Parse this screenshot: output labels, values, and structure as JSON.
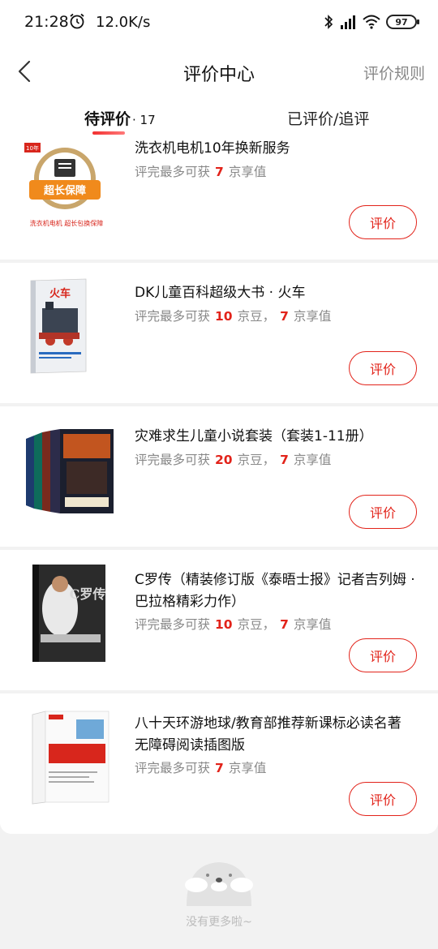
{
  "status_bar": {
    "time": "21:28",
    "speed": "12.0K/s",
    "battery": "97"
  },
  "header": {
    "title": "评价中心",
    "rules": "评价规则"
  },
  "tabs": {
    "pending": "待评价",
    "pending_count": "· 17",
    "done": "已评价/追评",
    "active": "pending"
  },
  "products": [
    {
      "name": "洗衣机电机10年换新服务",
      "reward_prefix": "评完最多可获",
      "reward_items": [
        {
          "num": "7",
          "unit": "京享值"
        }
      ],
      "button": "评价",
      "thumb_caption": "超长保障",
      "thumb_sub": "洗衣机电机 超长包换保障",
      "thumb_badge": "10年"
    },
    {
      "name": "DK儿童百科超级大书 · 火车",
      "reward_prefix": "评完最多可获",
      "reward_items": [
        {
          "num": "10",
          "unit": "京豆，"
        },
        {
          "num": "7",
          "unit": "京享值"
        }
      ],
      "button": "评价",
      "thumb_caption": "火车"
    },
    {
      "name": "灾难求生儿童小说套装（套装1-11册）",
      "reward_prefix": "评完最多可获",
      "reward_items": [
        {
          "num": "20",
          "unit": "京豆，"
        },
        {
          "num": "7",
          "unit": "京享值"
        }
      ],
      "button": "评价"
    },
    {
      "name": "C罗传（精装修订版《泰晤士报》记者吉列姆 · 巴拉格精彩力作）",
      "reward_prefix": "评完最多可获",
      "reward_items": [
        {
          "num": "10",
          "unit": "京豆，"
        },
        {
          "num": "7",
          "unit": "京享值"
        }
      ],
      "button": "评价",
      "thumb_caption": "C罗传"
    },
    {
      "name": "八十天环游地球/教育部推荐新课标必读名著 无障碍阅读插图版",
      "reward_prefix": "评完最多可获",
      "reward_items": [
        {
          "num": "7",
          "unit": "京享值"
        }
      ],
      "button": "评价"
    }
  ],
  "footer": {
    "text": "没有更多啦~"
  },
  "colors": {
    "accent": "#e2231a",
    "muted": "#888888",
    "bg": "#f2f2f2"
  }
}
